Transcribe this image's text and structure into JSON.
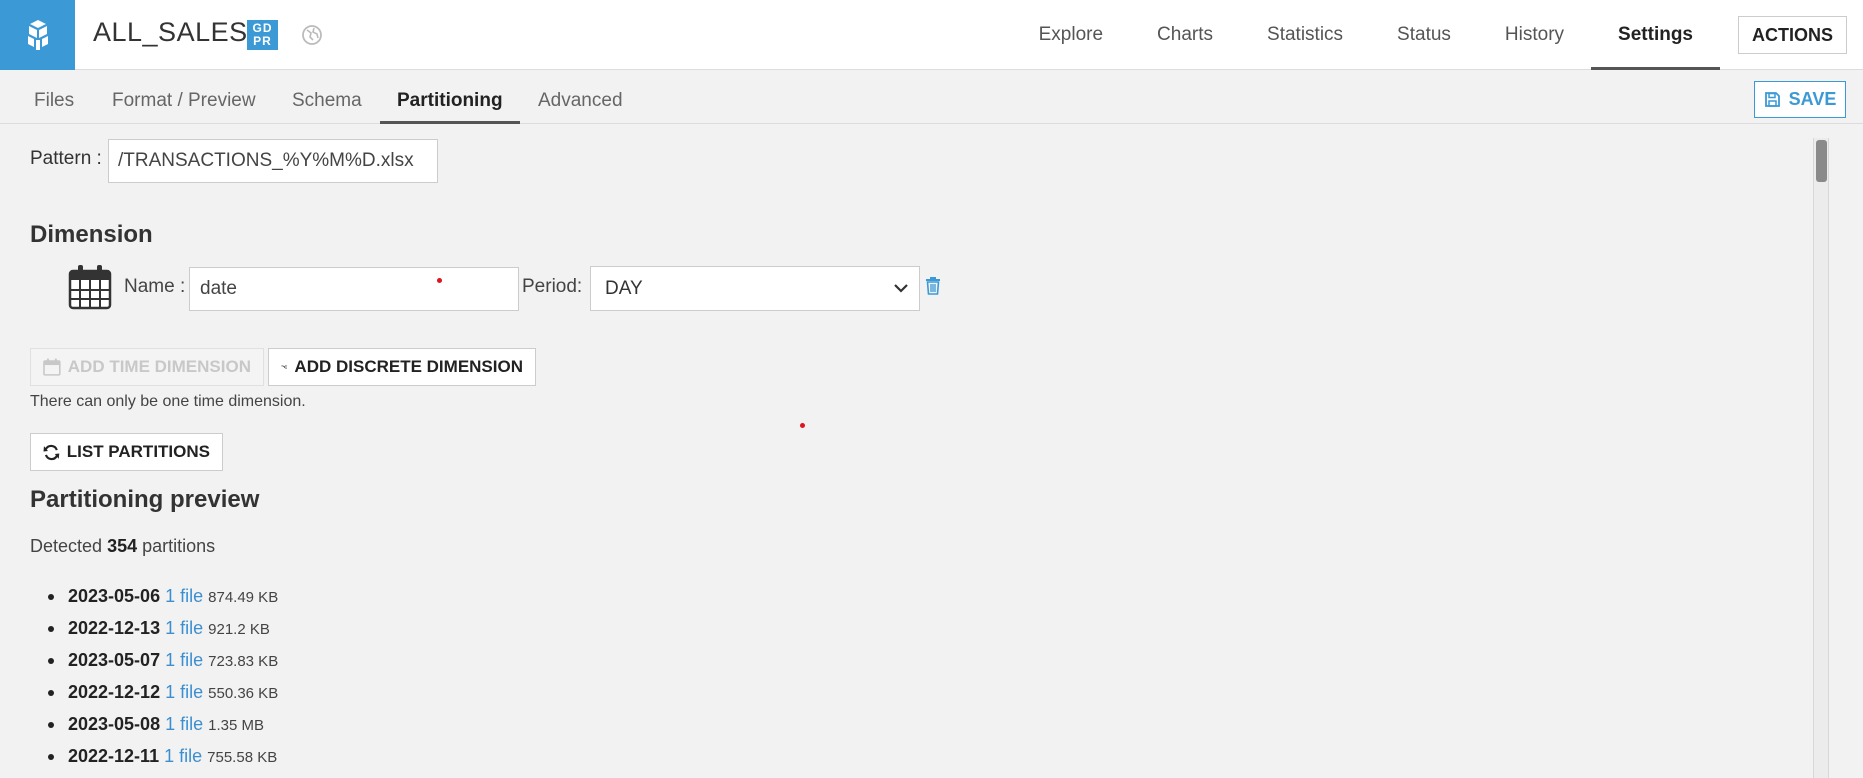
{
  "header": {
    "title": "ALL_SALES",
    "gdpr_badge": "GD PR",
    "nav": [
      {
        "label": "Explore",
        "active": false
      },
      {
        "label": "Charts",
        "active": false
      },
      {
        "label": "Statistics",
        "active": false
      },
      {
        "label": "Status",
        "active": false
      },
      {
        "label": "History",
        "active": false
      },
      {
        "label": "Settings",
        "active": true
      }
    ],
    "actions_label": "ACTIONS"
  },
  "subtabs": {
    "items": [
      {
        "label": "Files",
        "active": false
      },
      {
        "label": "Format / Preview",
        "active": false
      },
      {
        "label": "Schema",
        "active": false
      },
      {
        "label": "Partitioning",
        "active": true
      },
      {
        "label": "Advanced",
        "active": false
      }
    ],
    "save_label": "SAVE"
  },
  "pattern": {
    "label": "Pattern :",
    "value": "/TRANSACTIONS_%Y%M%D.xlsx"
  },
  "dimension": {
    "title": "Dimension",
    "name_label": "Name :",
    "name_value": "date",
    "period_label": "Period:",
    "period_value": "DAY"
  },
  "buttons": {
    "add_time": "ADD TIME DIMENSION",
    "add_discrete": "ADD DISCRETE DIMENSION",
    "list_partitions": "LIST PARTITIONS"
  },
  "help_text": "There can only be one time dimension.",
  "preview": {
    "title": "Partitioning preview",
    "detected_prefix": "Detected",
    "detected_count": "354",
    "detected_suffix": "partitions",
    "partitions": [
      {
        "date": "2023-05-06",
        "files": "1 file",
        "size": "874.49 KB"
      },
      {
        "date": "2022-12-13",
        "files": "1 file",
        "size": "921.2 KB"
      },
      {
        "date": "2023-05-07",
        "files": "1 file",
        "size": "723.83 KB"
      },
      {
        "date": "2022-12-12",
        "files": "1 file",
        "size": "550.36 KB"
      },
      {
        "date": "2023-05-08",
        "files": "1 file",
        "size": "1.35 MB"
      },
      {
        "date": "2022-12-11",
        "files": "1 file",
        "size": "755.58 KB"
      }
    ]
  },
  "colors": {
    "accent": "#3b99d6",
    "link": "#3b8fd0",
    "marker": "#e0141e"
  }
}
